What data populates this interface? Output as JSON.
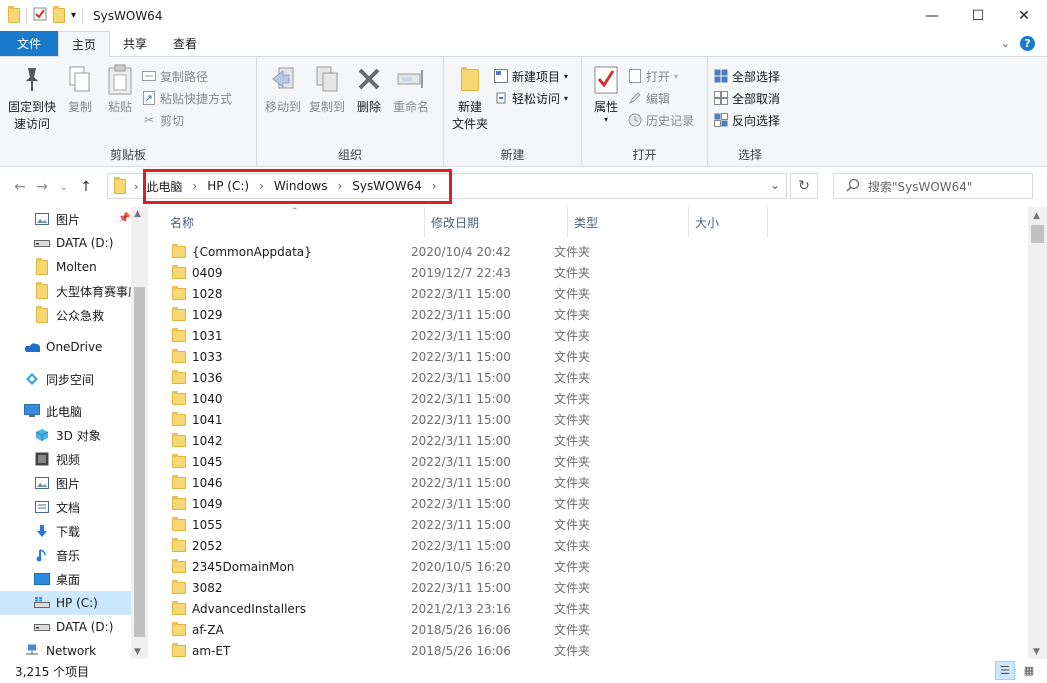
{
  "window": {
    "title": "SysWOW64",
    "minimize": "—",
    "maximize": "☐",
    "close": "✕"
  },
  "ribbon_tabs": [
    "文件",
    "主页",
    "共享",
    "查看"
  ],
  "ribbon": {
    "clipboard": {
      "label": "剪贴板",
      "pin": "固定到快\n速访问",
      "pin_line1": "固定到快",
      "pin_line2": "速访问",
      "copy": "复制",
      "paste": "粘贴",
      "copy_path": "复制路径",
      "paste_shortcut": "粘贴快捷方式",
      "cut": "剪切"
    },
    "organize": {
      "label": "组织",
      "move_to": "移动到",
      "copy_to": "复制到",
      "delete": "删除",
      "rename": "重命名"
    },
    "new": {
      "label": "新建",
      "new_folder_line1": "新建",
      "new_folder_line2": "文件夹",
      "new_item": "新建项目",
      "easy_access": "轻松访问"
    },
    "open": {
      "label": "打开",
      "properties": "属性",
      "open": "打开",
      "edit": "编辑",
      "history": "历史记录"
    },
    "select": {
      "label": "选择",
      "select_all": "全部选择",
      "select_none": "全部取消",
      "invert": "反向选择"
    }
  },
  "address": {
    "crumbs": [
      "此电脑",
      "HP (C:)",
      "Windows",
      "SysWOW64"
    ],
    "search_placeholder": "搜索\"SysWOW64\""
  },
  "nav_pane": [
    {
      "label": "图片",
      "icon": "pictures-icon",
      "level": 1
    },
    {
      "label": "DATA (D:)",
      "icon": "drive-icon",
      "level": 1
    },
    {
      "label": "Molten",
      "icon": "folder-icon",
      "level": 1
    },
    {
      "label": "大型体育赛事应",
      "icon": "folder-icon",
      "level": 1
    },
    {
      "label": "公众急救",
      "icon": "folder-icon",
      "level": 1
    },
    {
      "label": "",
      "icon": "",
      "level": -1
    },
    {
      "label": "OneDrive",
      "icon": "onedrive-icon",
      "level": 0
    },
    {
      "label": "",
      "icon": "",
      "level": -1
    },
    {
      "label": "同步空间",
      "icon": "sync-icon",
      "level": 0
    },
    {
      "label": "",
      "icon": "",
      "level": -1
    },
    {
      "label": "此电脑",
      "icon": "computer-icon",
      "level": 0
    },
    {
      "label": "3D 对象",
      "icon": "3d-objects-icon",
      "level": 1
    },
    {
      "label": "视频",
      "icon": "videos-icon",
      "level": 1
    },
    {
      "label": "图片",
      "icon": "pictures-icon",
      "level": 1
    },
    {
      "label": "文档",
      "icon": "documents-icon",
      "level": 1
    },
    {
      "label": "下载",
      "icon": "downloads-icon",
      "level": 1
    },
    {
      "label": "音乐",
      "icon": "music-icon",
      "level": 1
    },
    {
      "label": "桌面",
      "icon": "desktop-icon",
      "level": 1
    },
    {
      "label": "HP (C:)",
      "icon": "windows-drive-icon",
      "level": 1,
      "selected": true
    },
    {
      "label": "DATA (D:)",
      "icon": "drive-icon",
      "level": 1
    },
    {
      "label": "Network",
      "icon": "network-icon",
      "level": 0
    }
  ],
  "columns": {
    "name": "名称",
    "date": "修改日期",
    "type": "类型",
    "size": "大小"
  },
  "files": [
    {
      "name": "{CommonAppdata}",
      "date": "2020/10/4 20:42",
      "type": "文件夹"
    },
    {
      "name": "0409",
      "date": "2019/12/7 22:43",
      "type": "文件夹"
    },
    {
      "name": "1028",
      "date": "2022/3/11 15:00",
      "type": "文件夹"
    },
    {
      "name": "1029",
      "date": "2022/3/11 15:00",
      "type": "文件夹"
    },
    {
      "name": "1031",
      "date": "2022/3/11 15:00",
      "type": "文件夹"
    },
    {
      "name": "1033",
      "date": "2022/3/11 15:00",
      "type": "文件夹"
    },
    {
      "name": "1036",
      "date": "2022/3/11 15:00",
      "type": "文件夹"
    },
    {
      "name": "1040",
      "date": "2022/3/11 15:00",
      "type": "文件夹"
    },
    {
      "name": "1041",
      "date": "2022/3/11 15:00",
      "type": "文件夹"
    },
    {
      "name": "1042",
      "date": "2022/3/11 15:00",
      "type": "文件夹"
    },
    {
      "name": "1045",
      "date": "2022/3/11 15:00",
      "type": "文件夹"
    },
    {
      "name": "1046",
      "date": "2022/3/11 15:00",
      "type": "文件夹"
    },
    {
      "name": "1049",
      "date": "2022/3/11 15:00",
      "type": "文件夹"
    },
    {
      "name": "1055",
      "date": "2022/3/11 15:00",
      "type": "文件夹"
    },
    {
      "name": "2052",
      "date": "2022/3/11 15:00",
      "type": "文件夹"
    },
    {
      "name": "2345DomainMon",
      "date": "2020/10/5 16:20",
      "type": "文件夹"
    },
    {
      "name": "3082",
      "date": "2022/3/11 15:00",
      "type": "文件夹"
    },
    {
      "name": "AdvancedInstallers",
      "date": "2021/2/13 23:16",
      "type": "文件夹"
    },
    {
      "name": "af-ZA",
      "date": "2018/5/26 16:06",
      "type": "文件夹"
    },
    {
      "name": "am-ET",
      "date": "2018/5/26 16:06",
      "type": "文件夹"
    }
  ],
  "status": {
    "item_count": "3,215 个项目"
  },
  "colors": {
    "file_tab": "#1979ca",
    "highlight_box": "#e02020",
    "selection": "#cce8ff",
    "folder": "#f8d775"
  }
}
